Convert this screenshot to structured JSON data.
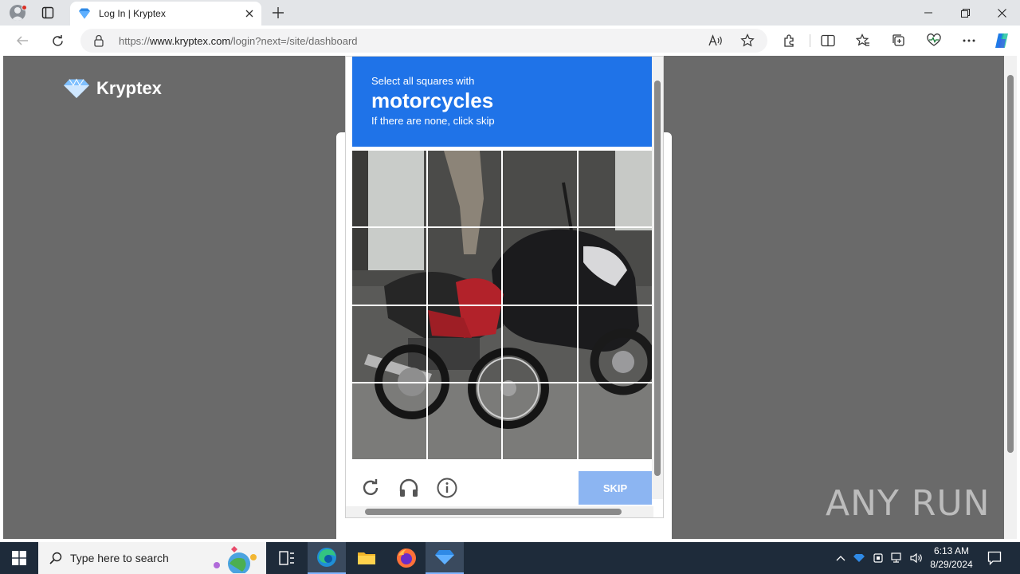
{
  "browser": {
    "tab": {
      "title": "Log In | Kryptex"
    },
    "address": {
      "url_prefix": "https://",
      "url_host": "www.kryptex.com",
      "url_path": "/login?next=/site/dashboard"
    }
  },
  "page": {
    "brand": {
      "name": "Kryptex"
    },
    "captcha": {
      "instruction": "Select all squares with",
      "target": "motorcycles",
      "hint": "If there are none, click skip",
      "skip_label": "SKIP",
      "grid_rows": 4,
      "grid_cols": 4
    }
  },
  "watermark": {
    "text": "ANY RUN"
  },
  "taskbar": {
    "search_placeholder": "Type here to search",
    "time": "6:13 AM",
    "date": "8/29/2024"
  },
  "colors": {
    "captcha_header": "#1f73e8",
    "skip_button": "#8cb5f2",
    "page_overlay": "#6a6a6a",
    "taskbar": "#1e2b3a"
  },
  "icons": [
    "profile-icon",
    "tab-actions-icon",
    "kryptex-favicon",
    "close-icon",
    "plus-icon",
    "minimize-icon",
    "restore-icon",
    "back-icon",
    "refresh-icon",
    "lock-icon",
    "read-aloud-icon",
    "star-icon",
    "extensions-icon",
    "split-screen-icon",
    "favorites-icon",
    "collections-icon",
    "performance-icon",
    "more-icon",
    "copilot-icon",
    "reload-challenge-icon",
    "headphones-icon",
    "info-icon",
    "windows-icon",
    "search-icon",
    "task-view-icon",
    "edge-icon",
    "folder-icon",
    "firefox-icon",
    "chevron-up-icon",
    "network-icon",
    "volume-icon",
    "notification-icon"
  ]
}
